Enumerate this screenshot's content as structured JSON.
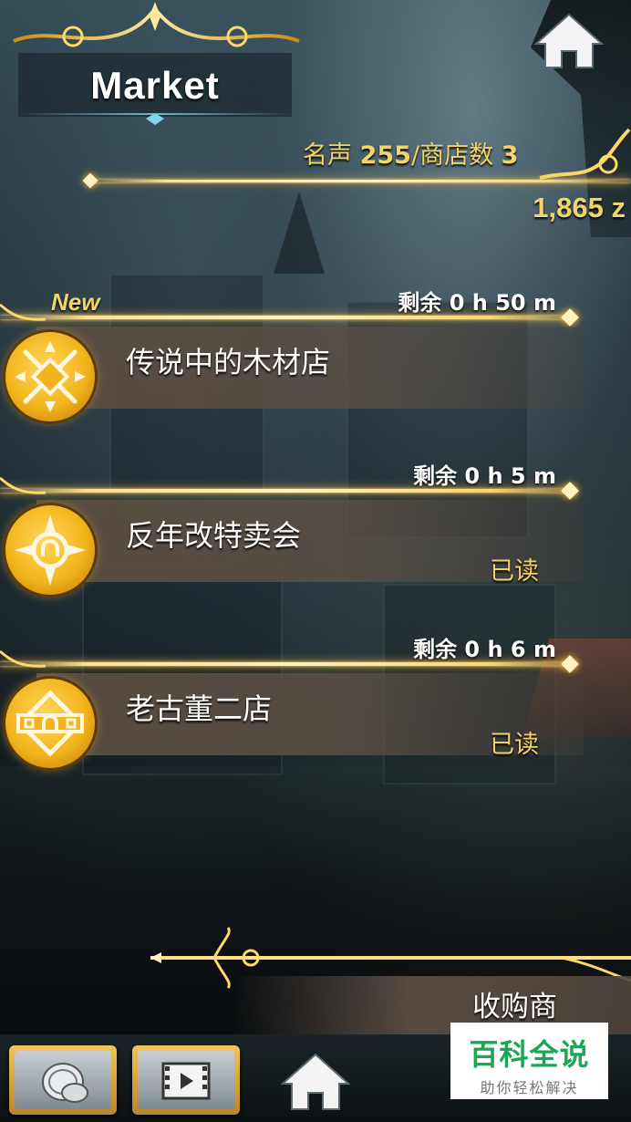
{
  "header": {
    "title": "Market",
    "stat_label_fame": "名声",
    "fame_value": "255",
    "stat_label_shops": "/商店数",
    "shop_count": "3",
    "money": "1,865 z"
  },
  "shops": [
    {
      "timer": "剩余 0 h 50 m",
      "is_new": true,
      "new_tag": "New",
      "name": "传说中的木材店",
      "read_label": "",
      "emblem_icon": "crossed-spears-emblem-icon"
    },
    {
      "timer": "剩余 0 h 5 m",
      "is_new": false,
      "new_tag": "",
      "name": "反年改特卖会",
      "read_label": "已读",
      "emblem_icon": "sun-horseshoe-emblem-icon"
    },
    {
      "timer": "剩余 0 h 6 m",
      "is_new": false,
      "new_tag": "",
      "name": "老古董二店",
      "read_label": "已读",
      "emblem_icon": "diamond-horseshoe-emblem-icon"
    }
  ],
  "buyer": {
    "label": "收购商"
  },
  "bottom_nav": {
    "items": [
      "coin-stack-icon",
      "video-film-icon",
      "home-icon"
    ]
  },
  "watermark": {
    "main": "百科全说",
    "sub": "助你轻松解决"
  },
  "colors": {
    "gold_text": "#f2d46a",
    "rail": "#ffe08a",
    "panel": "#5a4e42",
    "watermark_green": "#1aa653"
  }
}
